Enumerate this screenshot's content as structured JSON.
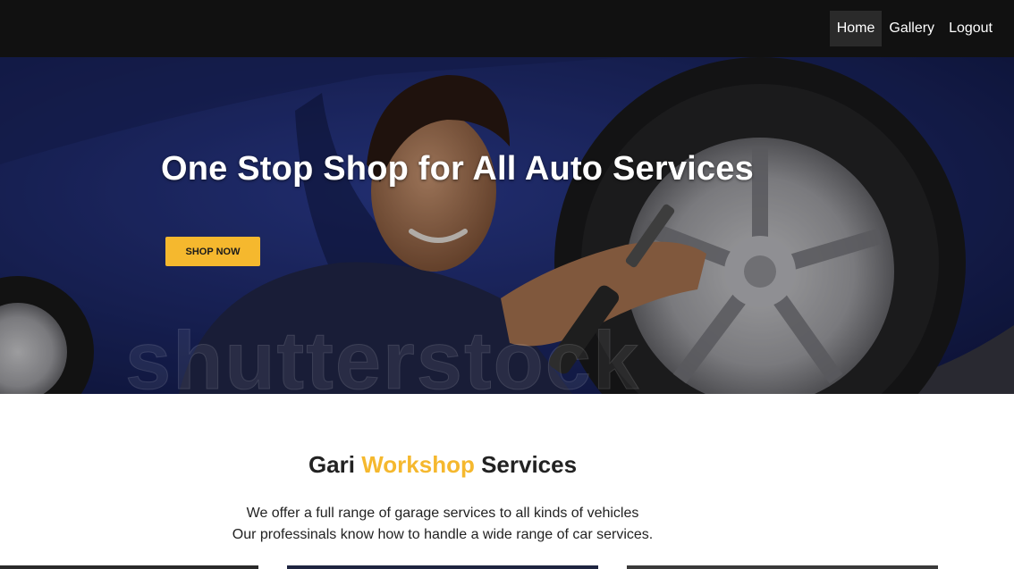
{
  "navbar": {
    "brand_fragment": "",
    "links": [
      {
        "label": "Home",
        "active": true
      },
      {
        "label": "Gallery",
        "active": false
      },
      {
        "label": "Logout",
        "active": false
      }
    ]
  },
  "hero": {
    "title": "One Stop Shop for All Auto Services",
    "button_label": "SHOP NOW",
    "watermark": "shutterstock"
  },
  "services": {
    "title_part1": "Gari",
    "title_accent": "Workshop",
    "title_part2": "Services",
    "description_line1": "We offer a full range of garage services to all kinds of vehicles",
    "description_line2": "Our professinals know how to handle a wide range of car services."
  },
  "colors": {
    "accent": "#f5b82e",
    "navbar_bg": "#111111"
  }
}
